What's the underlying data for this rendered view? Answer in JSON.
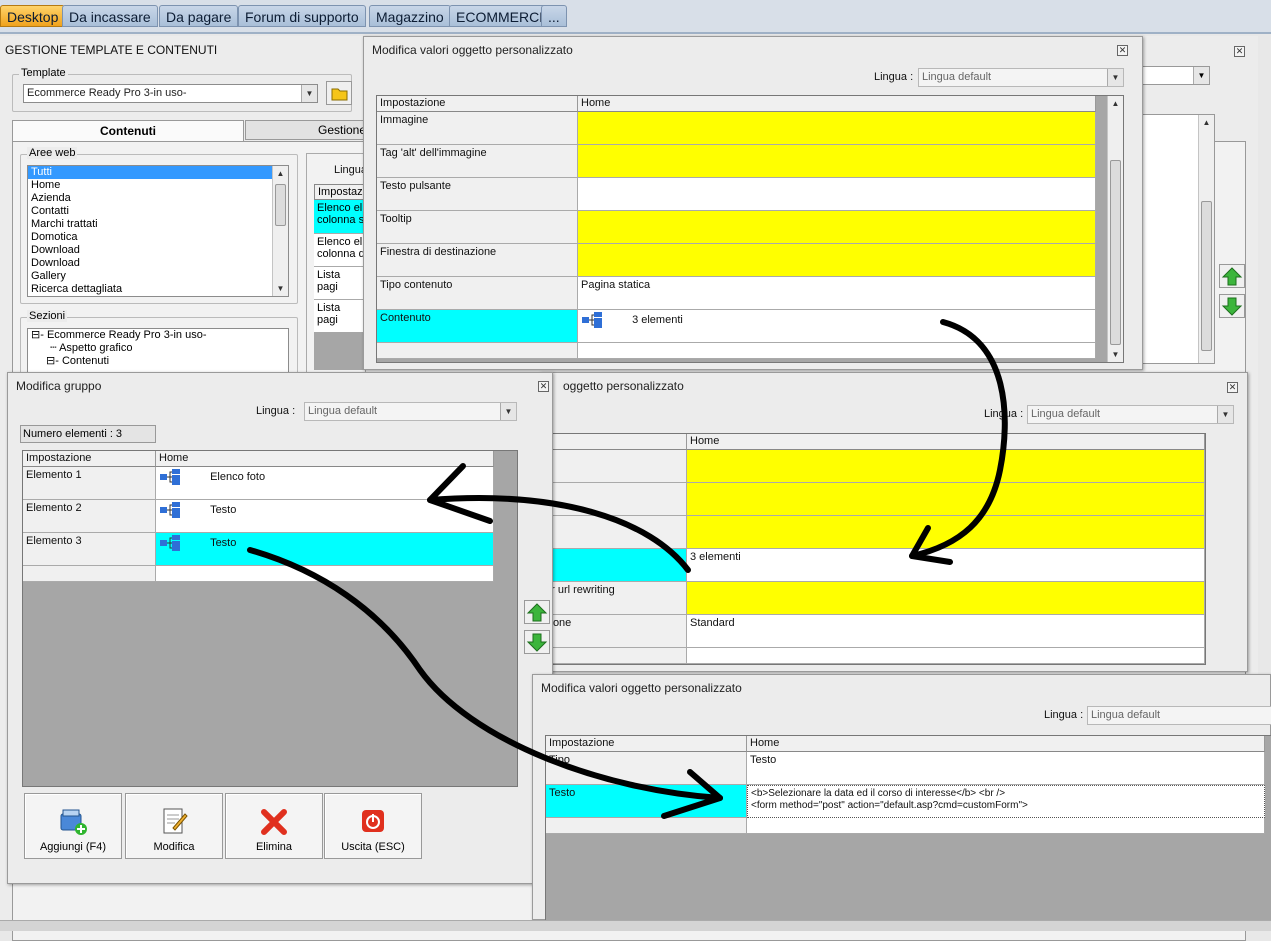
{
  "top_tabs": [
    "Desktop",
    "Da incassare",
    "Da pagare",
    "Forum di supporto",
    "Magazzino",
    "ECOMMERCE",
    "..."
  ],
  "main": {
    "title": "GESTIONE TEMPLATE E CONTENUTI",
    "template_label": "Template",
    "template_value": "Ecommerce Ready Pro 3-in uso-",
    "tab_contenuti": "Contenuti",
    "tab_gestione": "Gestione",
    "aree_web_label": "Aree web",
    "aree_web": [
      "Tutti",
      "Home",
      "Azienda",
      "Contatti",
      "Marchi trattati",
      "Domotica",
      "Download",
      "Download",
      "Gallery",
      "Ricerca dettagliata"
    ],
    "sezioni_label": "Sezioni",
    "sezioni": [
      "Ecommerce Ready Pro 3-in uso-",
      "Aspetto grafico",
      "Contenuti"
    ],
    "lingua_partial": "Lingua",
    "inner_header": "Impostazi",
    "inner_rows": [
      "Elenco el\ncolonna s",
      "Elenco el\ncolonna d",
      "Lista pagi",
      "Lista pagi"
    ]
  },
  "win_top": {
    "title": "Modifica valori oggetto personalizzato",
    "lingua_label": "Lingua :",
    "lingua_value": "Lingua default",
    "col_impostazione": "Impostazione",
    "col_home": "Home",
    "rows": [
      {
        "name": "Immagine",
        "value": ""
      },
      {
        "name": "Tag 'alt' dell'immagine",
        "value": ""
      },
      {
        "name": "Testo pulsante",
        "value": ""
      },
      {
        "name": "Tooltip",
        "value": ""
      },
      {
        "name": "Finestra di destinazione",
        "value": ""
      },
      {
        "name": "Tipo contenuto",
        "value": "Pagina statica"
      },
      {
        "name": "Contenuto",
        "value": "3 elementi"
      }
    ]
  },
  "win_group": {
    "title": "Modifica gruppo",
    "lingua_label": "Lingua :",
    "lingua_value": "Lingua default",
    "numero_elementi": "Numero elementi : 3",
    "col_impostazione": "Impostazione",
    "col_home": "Home",
    "rows": [
      {
        "name": "Elemento 1",
        "value": "Elenco foto"
      },
      {
        "name": "Elemento 2",
        "value": "Testo"
      },
      {
        "name": "Elemento 3",
        "value": "Testo"
      }
    ],
    "buttons": {
      "aggiungi": "Aggiungi (F4)",
      "modifica": "Modifica",
      "elimina": "Elimina",
      "uscita": "Uscita (ESC)"
    }
  },
  "win_mid": {
    "title": "oggetto personalizzato",
    "lingua_label": "Lingua :",
    "lingua_value": "Lingua default",
    "col_home": "Home",
    "rows": [
      {
        "name": "",
        "value": ""
      },
      {
        "name": "",
        "value": ""
      },
      {
        "name": "",
        "value": ""
      },
      {
        "name": "",
        "value": "3 elementi"
      },
      {
        "name": "er url rewriting",
        "value": ""
      },
      {
        "name": "zione",
        "value": "Standard"
      }
    ]
  },
  "win_bottom": {
    "title": "Modifica valori oggetto personalizzato",
    "lingua_label": "Lingua :",
    "lingua_value": "Lingua default",
    "col_impostazione": "Impostazione",
    "col_home": "Home",
    "rows": [
      {
        "name": "Tipo",
        "value": "Testo"
      },
      {
        "name": "Testo",
        "value": "<b>Selezionare la data ed il corso di interesse</b> <br />\n<form method=\"post\" action=\"default.asp?cmd=customForm\">"
      }
    ]
  },
  "colors": {
    "highlight_yellow": "#ffff00",
    "highlight_cyan": "#00ffff",
    "tab_active": "#f0a21c"
  }
}
